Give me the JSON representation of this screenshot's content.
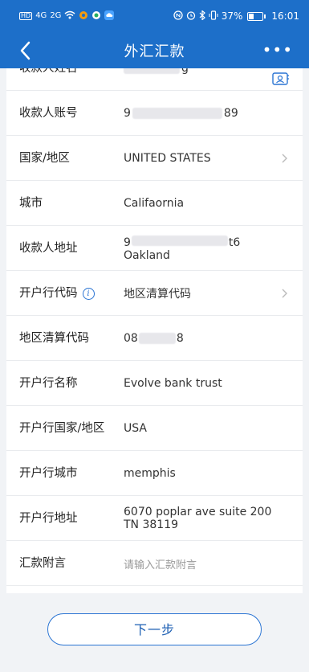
{
  "status_bar": {
    "left_label": "HD",
    "signal_a": "4G",
    "signal_b": "2G",
    "battery_pct": "37%",
    "time": "16:01"
  },
  "header": {
    "title": "外汇汇款",
    "more_label": "•••"
  },
  "form": {
    "payee_name_label": "收款人姓名",
    "payee_name_value_suffix": "g",
    "account_label": "收款人账号",
    "account_value_prefix": "9",
    "account_value_suffix": "89",
    "country_label": "国家/地区",
    "country_value": "UNITED STATES",
    "city_label": "城市",
    "city_value": "Califaornia",
    "address_label": "收款人地址",
    "address_line1_prefix": "9",
    "address_line1_suffix": "t6",
    "address_line2": "Oakland",
    "bank_code_label": "开户行代码",
    "bank_code_value": "地区清算代码",
    "clearing_code_label": "地区清算代码",
    "clearing_code_prefix": "08",
    "clearing_code_suffix": "8",
    "bank_name_label": "开户行名称",
    "bank_name_value": "Evolve bank trust",
    "bank_country_label": "开户行国家/地区",
    "bank_country_value": "USA",
    "bank_city_label": "开户行城市",
    "bank_city_value": "memphis",
    "bank_address_label": "开户行地址",
    "bank_address_line1": "6070 poplar ave suite 200",
    "bank_address_line2": "TN 38119",
    "remark_label": "汇款附言",
    "remark_placeholder": "请输入汇款附言"
  },
  "footer": {
    "next_label": "下一步"
  },
  "colors": {
    "header_bg": "#1d6fc9",
    "accent": "#2a74d3"
  }
}
